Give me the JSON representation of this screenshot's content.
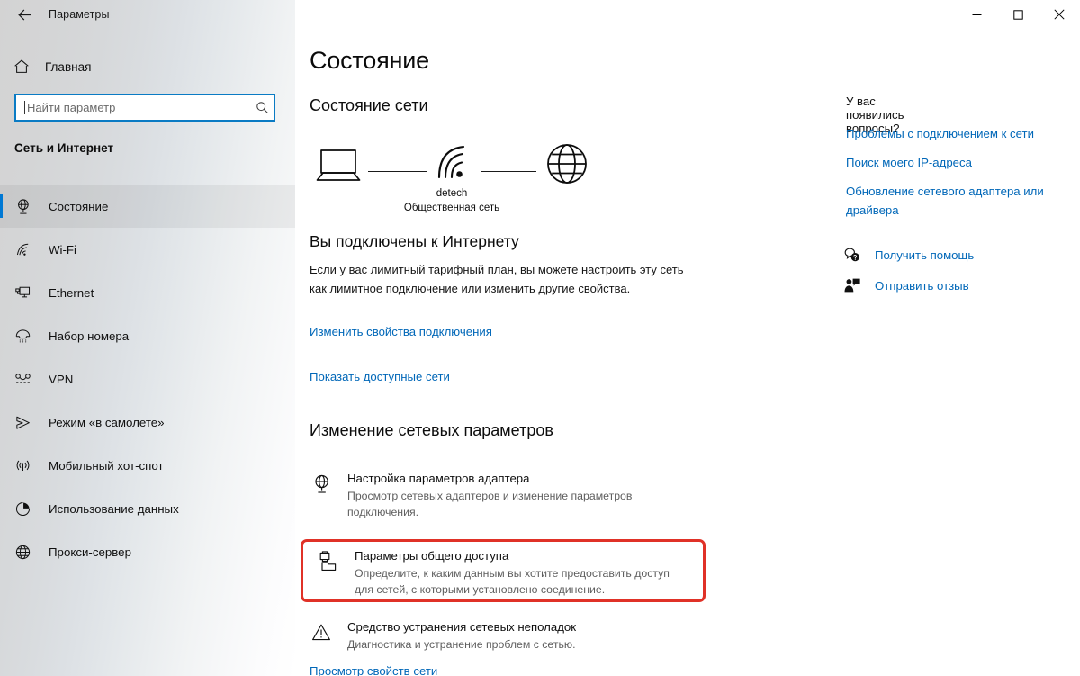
{
  "window": {
    "app_title": "Параметры",
    "back_icon": "back-arrow-icon",
    "controls": {
      "minimize": "—",
      "maximize": "□",
      "close": "✕"
    }
  },
  "sidebar": {
    "home_label": "Главная",
    "home_icon": "home-icon",
    "search": {
      "value": "",
      "placeholder": "Найти параметр",
      "icon": "search-icon"
    },
    "group_title": "Сеть и Интернет",
    "items": [
      {
        "label": "Состояние",
        "icon": "network-status-icon",
        "selected": true
      },
      {
        "label": "Wi-Fi",
        "icon": "wifi-icon",
        "selected": false
      },
      {
        "label": "Ethernet",
        "icon": "ethernet-icon",
        "selected": false
      },
      {
        "label": "Набор номера",
        "icon": "dialup-icon",
        "selected": false
      },
      {
        "label": "VPN",
        "icon": "vpn-icon",
        "selected": false
      },
      {
        "label": "Режим «в самолете»",
        "icon": "airplane-icon",
        "selected": false
      },
      {
        "label": "Мобильный хот-спот",
        "icon": "hotspot-icon",
        "selected": false
      },
      {
        "label": "Использование данных",
        "icon": "data-usage-icon",
        "selected": false
      },
      {
        "label": "Прокси-сервер",
        "icon": "proxy-icon",
        "selected": false
      }
    ]
  },
  "main": {
    "page_title": "Состояние",
    "network_status_heading": "Состояние сети",
    "diagram": {
      "device_icon": "laptop-icon",
      "link_icon": "wifi-signal-icon",
      "internet_icon": "globe-icon",
      "ssid": "detech",
      "network_type": "Общественная сеть"
    },
    "connection": {
      "title": "Вы подключены к Интернету",
      "description": "Если у вас лимитный тарифный план, вы можете настроить эту сеть как лимитное подключение или изменить другие свойства.",
      "change_properties_link": "Изменить свойства подключения",
      "show_networks_link": "Показать доступные сети"
    },
    "change_settings_heading": "Изменение сетевых параметров",
    "settings_rows": [
      {
        "title": "Настройка параметров адаптера",
        "subtitle": "Просмотр сетевых адаптеров и изменение параметров подключения.",
        "icon": "adapter-settings-icon",
        "highlighted": false
      },
      {
        "title": "Параметры общего доступа",
        "subtitle": "Определите, к каким данным вы хотите предоставить доступ для сетей, с которыми установлено соединение.",
        "icon": "sharing-options-icon",
        "highlighted": true
      },
      {
        "title": "Средство устранения сетевых неполадок",
        "subtitle": "Диагностика и устранение проблем с сетью.",
        "icon": "troubleshoot-warning-icon",
        "highlighted": false
      }
    ],
    "view_properties_link": "Просмотр свойств сети"
  },
  "help": {
    "title": "У вас появились вопросы?",
    "links": [
      "Проблемы с подключением к сети",
      "Поиск моего IP-адреса",
      "Обновление сетевого адаптера или драйвера"
    ],
    "actions": [
      {
        "label": "Получить помощь",
        "icon": "get-help-icon"
      },
      {
        "label": "Отправить отзыв",
        "icon": "send-feedback-icon"
      }
    ]
  },
  "colors": {
    "accent": "#0078d4",
    "link": "#0067b8",
    "highlight_box": "#e03127",
    "search_focus_border": "#0a7bc4"
  }
}
